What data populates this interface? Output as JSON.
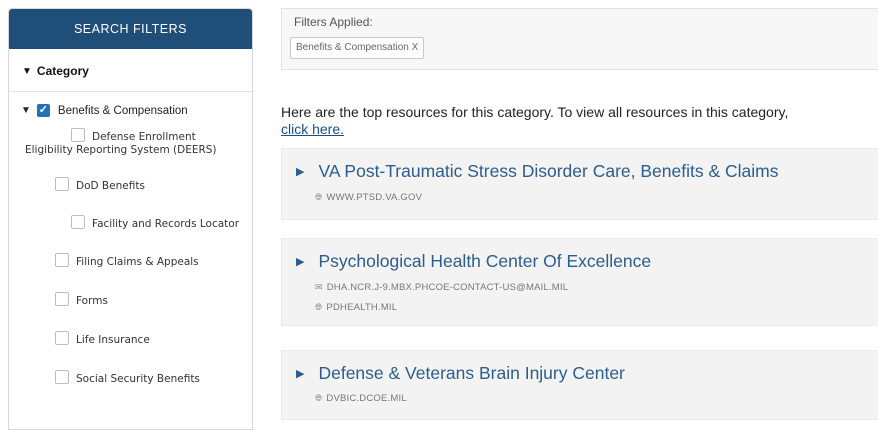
{
  "sidebar": {
    "header": "SEARCH FILTERS",
    "category_label": "Category",
    "parent": {
      "label": "Benefits & Compensation",
      "checked": true
    },
    "children": [
      {
        "label": "Defense Enrollment Eligibility Reporting System (DEERS)"
      },
      {
        "label": "DoD Benefits"
      },
      {
        "label": "Facility and Records Locator"
      },
      {
        "label": "Filing Claims & Appeals"
      },
      {
        "label": "Forms"
      },
      {
        "label": "Life Insurance"
      },
      {
        "label": "Social Security Benefits"
      }
    ]
  },
  "filters": {
    "label": "Filters Applied:",
    "chips": [
      "Benefits & Compensation X"
    ]
  },
  "intro": {
    "text": "Here are the top resources for this category. To view all resources in this category,",
    "link": "click here."
  },
  "resources": [
    {
      "title": "VA Post-Traumatic Stress Disorder Care, Benefits & Claims",
      "website": "WWW.PTSD.VA.GOV"
    },
    {
      "title": "Psychological Health Center Of Excellence",
      "email": "DHA.NCR.J-9.MBX.PHCOE-CONTACT-US@MAIL.MIL",
      "website": "PDHEALTH.MIL"
    },
    {
      "title": "Defense & Veterans Brain Injury Center",
      "website": "DVBIC.DCOE.MIL"
    }
  ],
  "colors": {
    "header_bg": "#1f4e79",
    "checkbox": "#2471b6",
    "link": "#1a4e8c",
    "title": "#2b5d8e"
  },
  "icons": {
    "expand": "triangle-down-icon",
    "resource": "triangle-right-icon",
    "web": "globe-icon",
    "email": "envelope-icon"
  }
}
